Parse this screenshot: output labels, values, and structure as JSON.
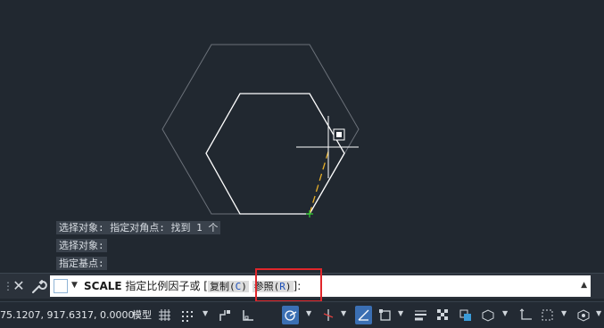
{
  "history": [
    "选择对象: 指定对角点: 找到 1 个",
    "选择对象:",
    "指定基点:"
  ],
  "command": {
    "name": "SCALE",
    "prompt": "指定比例因子或",
    "bracket_open": "[",
    "opt1_label": "复制(",
    "opt1_key": "C",
    "opt1_close": ")",
    "opt2_label": "参照(",
    "opt2_key": "R",
    "opt2_close": ")",
    "bracket_close": "]:"
  },
  "status": {
    "coordinates": "75.1207, 917.6317, 0.0000",
    "model_label": "模型"
  },
  "colors": {
    "background": "#212830",
    "highlight": "#e0262b",
    "active_toggle": "#3b6fb3"
  }
}
